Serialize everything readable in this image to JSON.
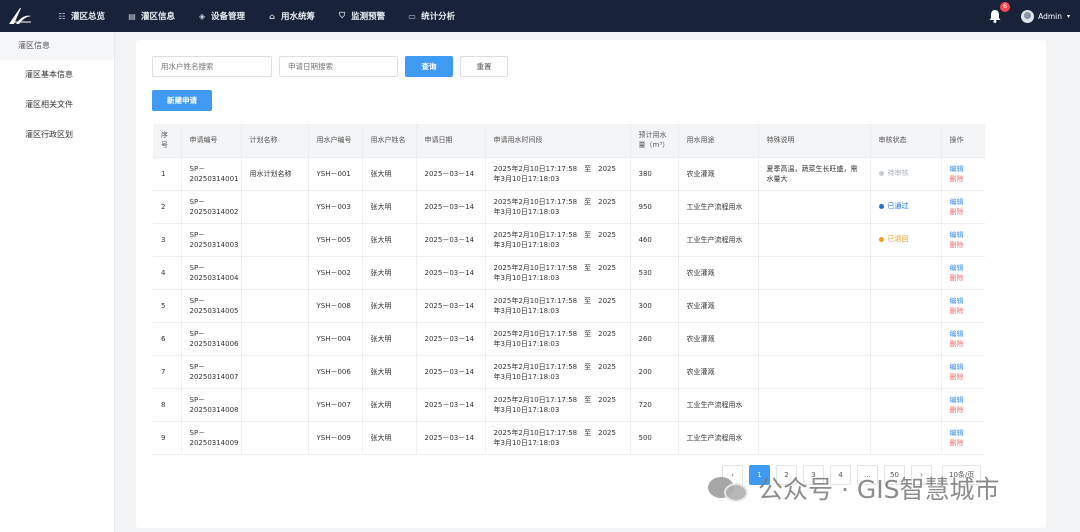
{
  "nav": [
    {
      "icon": "grid-icon",
      "glyph": "☷",
      "label": "灌区总览"
    },
    {
      "icon": "document-icon",
      "glyph": "▤",
      "label": "灌区信息"
    },
    {
      "icon": "cube-icon",
      "glyph": "◈",
      "label": "设备管理"
    },
    {
      "icon": "home-icon",
      "glyph": "⌂",
      "label": "用水统筹"
    },
    {
      "icon": "shield-icon",
      "glyph": "⛉",
      "label": "监测预警"
    },
    {
      "icon": "monitor-icon",
      "glyph": "▭",
      "label": "统计分析"
    }
  ],
  "top_right": {
    "badge": "6",
    "user": "Admin"
  },
  "sidebar": {
    "header": "灌区信息",
    "items": [
      "灌区基本信息",
      "灌区相关文件",
      "灌区行政区划"
    ]
  },
  "search": {
    "name_placeholder": "用水户姓名搜索",
    "date_placeholder": "申请日期搜索",
    "query": "查询",
    "reset": "重置",
    "new": "新建申请"
  },
  "table": {
    "headers": [
      "序号",
      "申请编号",
      "计划名称",
      "用水户编号",
      "用水户姓名",
      "申请日期",
      "申请用水时间段",
      "预计用水量（m³）",
      "用水用途",
      "特殊说明",
      "审核状态",
      "操作"
    ],
    "edit": "编辑",
    "delete": "删除",
    "rows": [
      {
        "no": "1",
        "code": "SP－20250314001",
        "plan": "用水计划名称",
        "uid": "YSH－001",
        "name": "张大明",
        "date": "2025－03－14",
        "period": "2025年2月10日17:17:58　至　2025年3月10日17:18:03",
        "volume": "380",
        "use": "农业灌溉",
        "note": "夏季高温，蔬菜生长旺盛，需水量大",
        "status": "待审核",
        "status_type": "pending"
      },
      {
        "no": "2",
        "code": "SP－20250314002",
        "plan": "",
        "uid": "YSH－003",
        "name": "张大明",
        "date": "2025－03－14",
        "period": "2025年2月10日17:17:58　至　2025年3月10日17:18:03",
        "volume": "950",
        "use": "工业生产流程用水",
        "note": "",
        "status": "已通过",
        "status_type": "ok"
      },
      {
        "no": "3",
        "code": "SP－20250314003",
        "plan": "",
        "uid": "YSH－005",
        "name": "张大明",
        "date": "2025－03－14",
        "period": "2025年2月10日17:17:58　至　2025年3月10日17:18:03",
        "volume": "460",
        "use": "工业生产流程用水",
        "note": "",
        "status": "已退回",
        "status_type": "back"
      },
      {
        "no": "4",
        "code": "SP－20250314004",
        "plan": "",
        "uid": "YSH－002",
        "name": "张大明",
        "date": "2025－03－14",
        "period": "2025年2月10日17:17:58　至　2025年3月10日17:18:03",
        "volume": "530",
        "use": "农业灌溉",
        "note": "",
        "status": "",
        "status_type": ""
      },
      {
        "no": "5",
        "code": "SP－20250314005",
        "plan": "",
        "uid": "YSH－008",
        "name": "张大明",
        "date": "2025－03－14",
        "period": "2025年2月10日17:17:58　至　2025年3月10日17:18:03",
        "volume": "300",
        "use": "农业灌溉",
        "note": "",
        "status": "",
        "status_type": ""
      },
      {
        "no": "6",
        "code": "SP－20250314006",
        "plan": "",
        "uid": "YSH－004",
        "name": "张大明",
        "date": "2025－03－14",
        "period": "2025年2月10日17:17:58　至　2025年3月10日17:18:03",
        "volume": "260",
        "use": "农业灌溉",
        "note": "",
        "status": "",
        "status_type": ""
      },
      {
        "no": "7",
        "code": "SP－20250314007",
        "plan": "",
        "uid": "YSH－006",
        "name": "张大明",
        "date": "2025－03－14",
        "period": "2025年2月10日17:17:58　至　2025年3月10日17:18:03",
        "volume": "200",
        "use": "农业灌溉",
        "note": "",
        "status": "",
        "status_type": ""
      },
      {
        "no": "8",
        "code": "SP－20250314008",
        "plan": "",
        "uid": "YSH－007",
        "name": "张大明",
        "date": "2025－03－14",
        "period": "2025年2月10日17:17:58　至　2025年3月10日17:18:03",
        "volume": "720",
        "use": "工业生产流程用水",
        "note": "",
        "status": "",
        "status_type": ""
      },
      {
        "no": "9",
        "code": "SP－20250314009",
        "plan": "",
        "uid": "YSH－009",
        "name": "张大明",
        "date": "2025－03－14",
        "period": "2025年2月10日17:17:58　至　2025年3月10日17:18:03",
        "volume": "500",
        "use": "工业生产流程用水",
        "note": "",
        "status": "",
        "status_type": ""
      }
    ]
  },
  "pagination": {
    "prev": "‹",
    "pages": [
      "1",
      "2",
      "3",
      "4",
      "…",
      "50"
    ],
    "next": "›",
    "active": "1",
    "page_size": "10条/页"
  },
  "watermark": "公众号 · GIS智慧城市"
}
